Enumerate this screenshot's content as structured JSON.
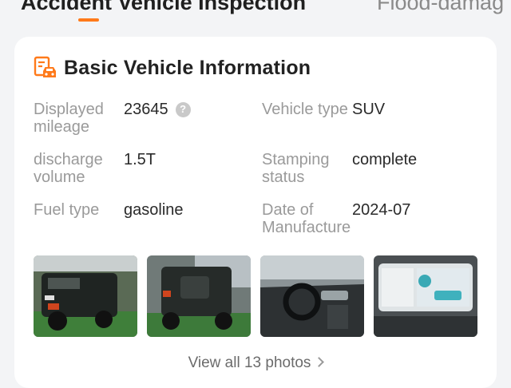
{
  "tabs": [
    {
      "label": "Accident Vehicle Inspection",
      "active": true
    },
    {
      "label": "Flood-damag",
      "active": false
    }
  ],
  "accent_color": "#ff7a1a",
  "card": {
    "title": "Basic Vehicle Information",
    "title_icon": "car-document-icon",
    "fields": {
      "mileage": {
        "label": "Displayed mileage",
        "value": "23645",
        "icon": "help-icon"
      },
      "vehicle_type": {
        "label": "Vehicle type",
        "value": "SUV"
      },
      "displacement": {
        "label": "discharge volume",
        "value": "1.5T"
      },
      "stamping": {
        "label": "Stamping status",
        "value": "complete"
      },
      "fuel": {
        "label": "Fuel type",
        "value": "gasoline"
      },
      "manufacture_date": {
        "label": "Date of Manufacture",
        "value": "2024-07"
      }
    },
    "help_glyph": "?",
    "photos": [
      {
        "subject": "vehicle-front-exterior-photo"
      },
      {
        "subject": "vehicle-rear-exterior-photo"
      },
      {
        "subject": "vehicle-interior-photo"
      },
      {
        "subject": "vehicle-dashboard-screen-photo"
      }
    ],
    "view_all_label": "View all 13 photos"
  }
}
